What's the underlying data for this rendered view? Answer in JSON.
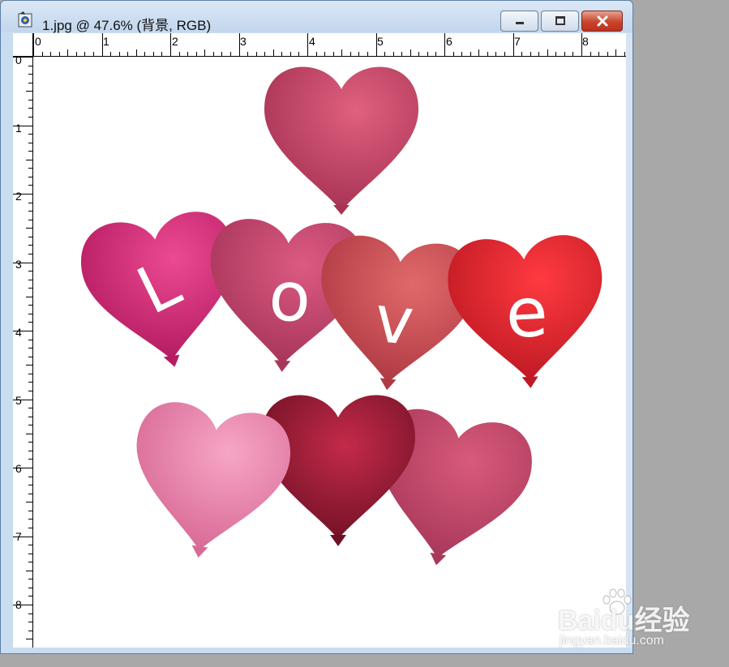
{
  "window": {
    "title": "1.jpg @ 47.6% (背景, RGB)",
    "controls": {
      "minimize": "minimize",
      "maximize": "maximize",
      "close": "close"
    }
  },
  "rulers": {
    "horizontal": [
      "0",
      "1",
      "2",
      "3",
      "4",
      "5",
      "6",
      "7",
      "8"
    ],
    "vertical": [
      "0",
      "1",
      "2",
      "3",
      "4",
      "5",
      "6",
      "7",
      "8"
    ]
  },
  "image": {
    "letters": [
      "L",
      "o",
      "v",
      "e"
    ],
    "colors": {
      "top": "#c44566",
      "l": "#d4307a",
      "o": "#c0456a",
      "v": "#c94a52",
      "e": "#e0262e",
      "pink": "#ea86ad",
      "crimson": "#a0203a",
      "rose": "#c04a66"
    }
  },
  "watermark": {
    "main": "Baidu经验",
    "sub": "jingyan.baidu.com"
  }
}
